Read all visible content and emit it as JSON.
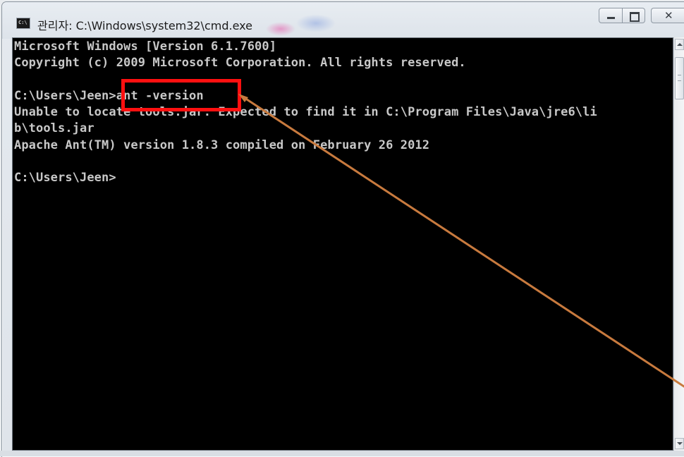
{
  "window": {
    "title": "관리자: C:\\Windows\\system32\\cmd.exe",
    "icon": "cmd-icon",
    "buttons": [
      "minimize-icon",
      "maximize-icon",
      "close-icon"
    ]
  },
  "console": {
    "lines": [
      "Microsoft Windows [Version 6.1.7600]",
      "Copyright (c) 2009 Microsoft Corporation. All rights reserved.",
      "",
      "C:\\Users\\Jeen>ant -version",
      "Unable to locate tools.jar. Expected to find it in C:\\Program Files\\Java\\jre6\\li",
      "b\\tools.jar",
      "Apache Ant(TM) version 1.8.3 compiled on February 26 2012",
      "",
      "C:\\Users\\Jeen>"
    ],
    "background": "#000000",
    "foreground": "#c8c8c8"
  },
  "annotation": {
    "highlight_color": "#ff1010",
    "arrow_color": "#c87a3e"
  }
}
